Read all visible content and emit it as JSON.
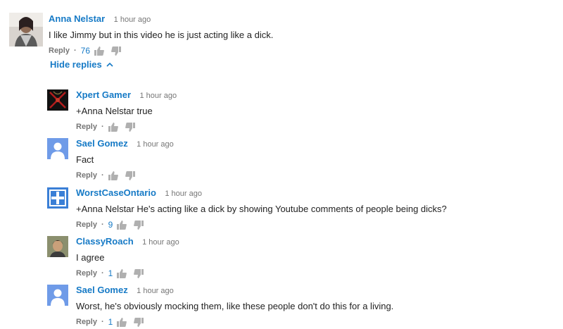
{
  "comments": [
    {
      "author": "Anna Nelstar",
      "time": "1 hour ago",
      "text": "I like Jimmy but in this video he is just acting like a dick.",
      "reply_label": "Reply",
      "likes": "76",
      "avatar": "photo-avatar"
    }
  ],
  "hide_replies_label": "Hide replies",
  "replies": [
    {
      "author": "Xpert Gamer",
      "time": "1 hour ago",
      "text": "+Anna Nelstar true",
      "reply_label": "Reply",
      "likes": "",
      "avatar": "dark-logo-avatar"
    },
    {
      "author": "Sael Gomez",
      "time": "1 hour ago",
      "text": "Fact",
      "reply_label": "Reply",
      "likes": "",
      "avatar": "default-user-avatar"
    },
    {
      "author": "WorstCaseOntario",
      "time": "1 hour ago",
      "text": "+Anna Nelstar He's acting like a dick by showing Youtube comments of people being dicks?",
      "reply_label": "Reply",
      "likes": "9",
      "avatar": "blue-cross-avatar"
    },
    {
      "author": "ClassyRoach",
      "time": "1 hour ago",
      "text": "I agree",
      "reply_label": "Reply",
      "likes": "1",
      "avatar": "photo-avatar"
    },
    {
      "author": "Sael Gomez",
      "time": "1 hour ago",
      "text": "Worst, he's obviously mocking them, like these people don't do this for a living.",
      "reply_label": "Reply",
      "likes": "1",
      "avatar": "default-user-avatar"
    }
  ],
  "colors": {
    "author_link": "#167ac6",
    "meta_gray": "#767676",
    "default_avatar_bg": "#6f9be8"
  }
}
